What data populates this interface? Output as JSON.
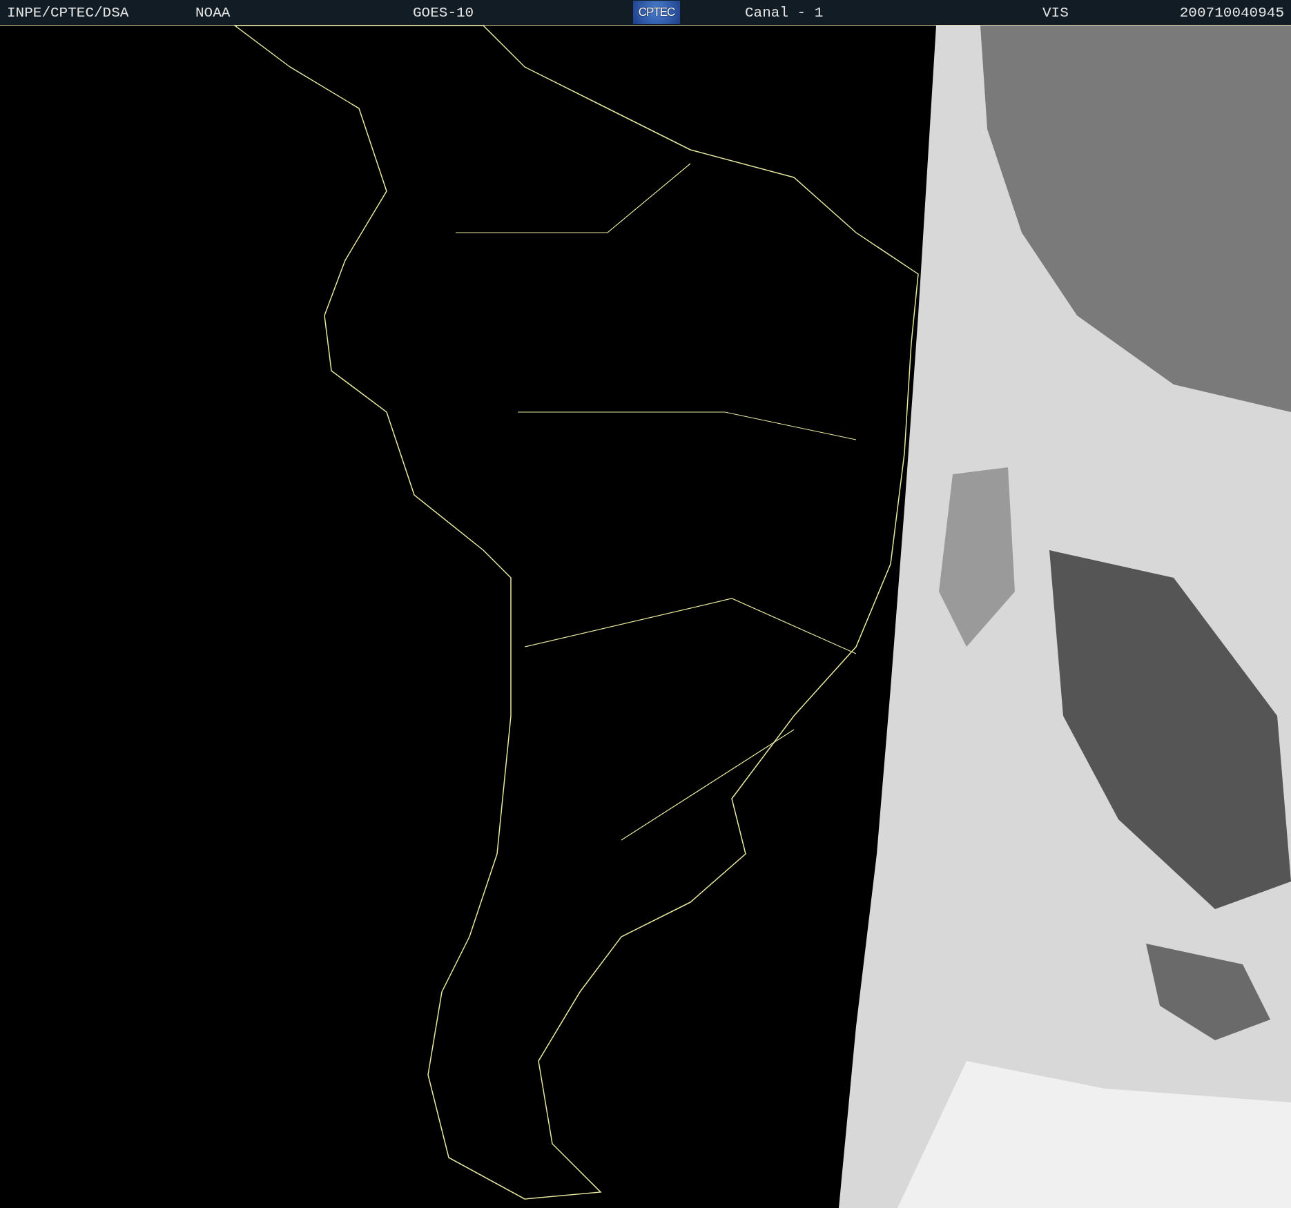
{
  "header": {
    "agency": "INPE/CPTEC/DSA",
    "source": "NOAA",
    "satellite": "GOES-10",
    "logo": "CPTEC",
    "channel": "Canal - 1",
    "band": "VIS",
    "timestamp": "200710040945"
  }
}
